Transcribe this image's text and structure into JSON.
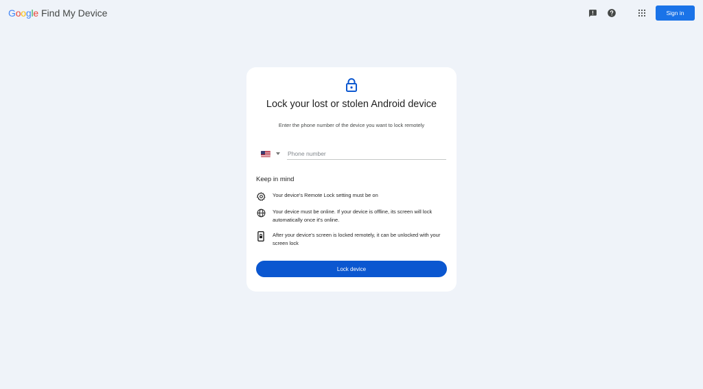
{
  "header": {
    "logo_letters": [
      {
        "char": "G",
        "color": "#4285F4"
      },
      {
        "char": "o",
        "color": "#EA4335"
      },
      {
        "char": "o",
        "color": "#FBBC05"
      },
      {
        "char": "g",
        "color": "#4285F4"
      },
      {
        "char": "l",
        "color": "#34A853"
      },
      {
        "char": "e",
        "color": "#EA4335"
      }
    ],
    "product_name": "Find My Device",
    "icons": [
      "feedback-icon",
      "help-icon",
      "apps-grid-icon"
    ],
    "sign_in_label": "Sign in"
  },
  "card": {
    "icon": "lock-icon",
    "title": "Lock your lost or stolen Android device",
    "subtitle": "Enter the phone number of the device you want to lock remotely",
    "phone": {
      "country_flag": "us-flag-icon",
      "placeholder": "Phone number",
      "value": ""
    },
    "keep_in_mind_heading": "Keep in mind",
    "tips": [
      {
        "icon": "settings-gear-icon",
        "text": "Your device's Remote Lock setting must be on"
      },
      {
        "icon": "globe-icon",
        "text": "Your device must be online. If your device is offline, its screen will lock automatically once it's online."
      },
      {
        "icon": "phone-lock-icon",
        "text": "After your device's screen is locked remotely, it can be unlocked with your screen lock"
      }
    ],
    "lock_button_label": "Lock device"
  },
  "colors": {
    "background": "#eff3f9",
    "primary": "#0b57d0",
    "sign_in": "#1a73e8"
  }
}
